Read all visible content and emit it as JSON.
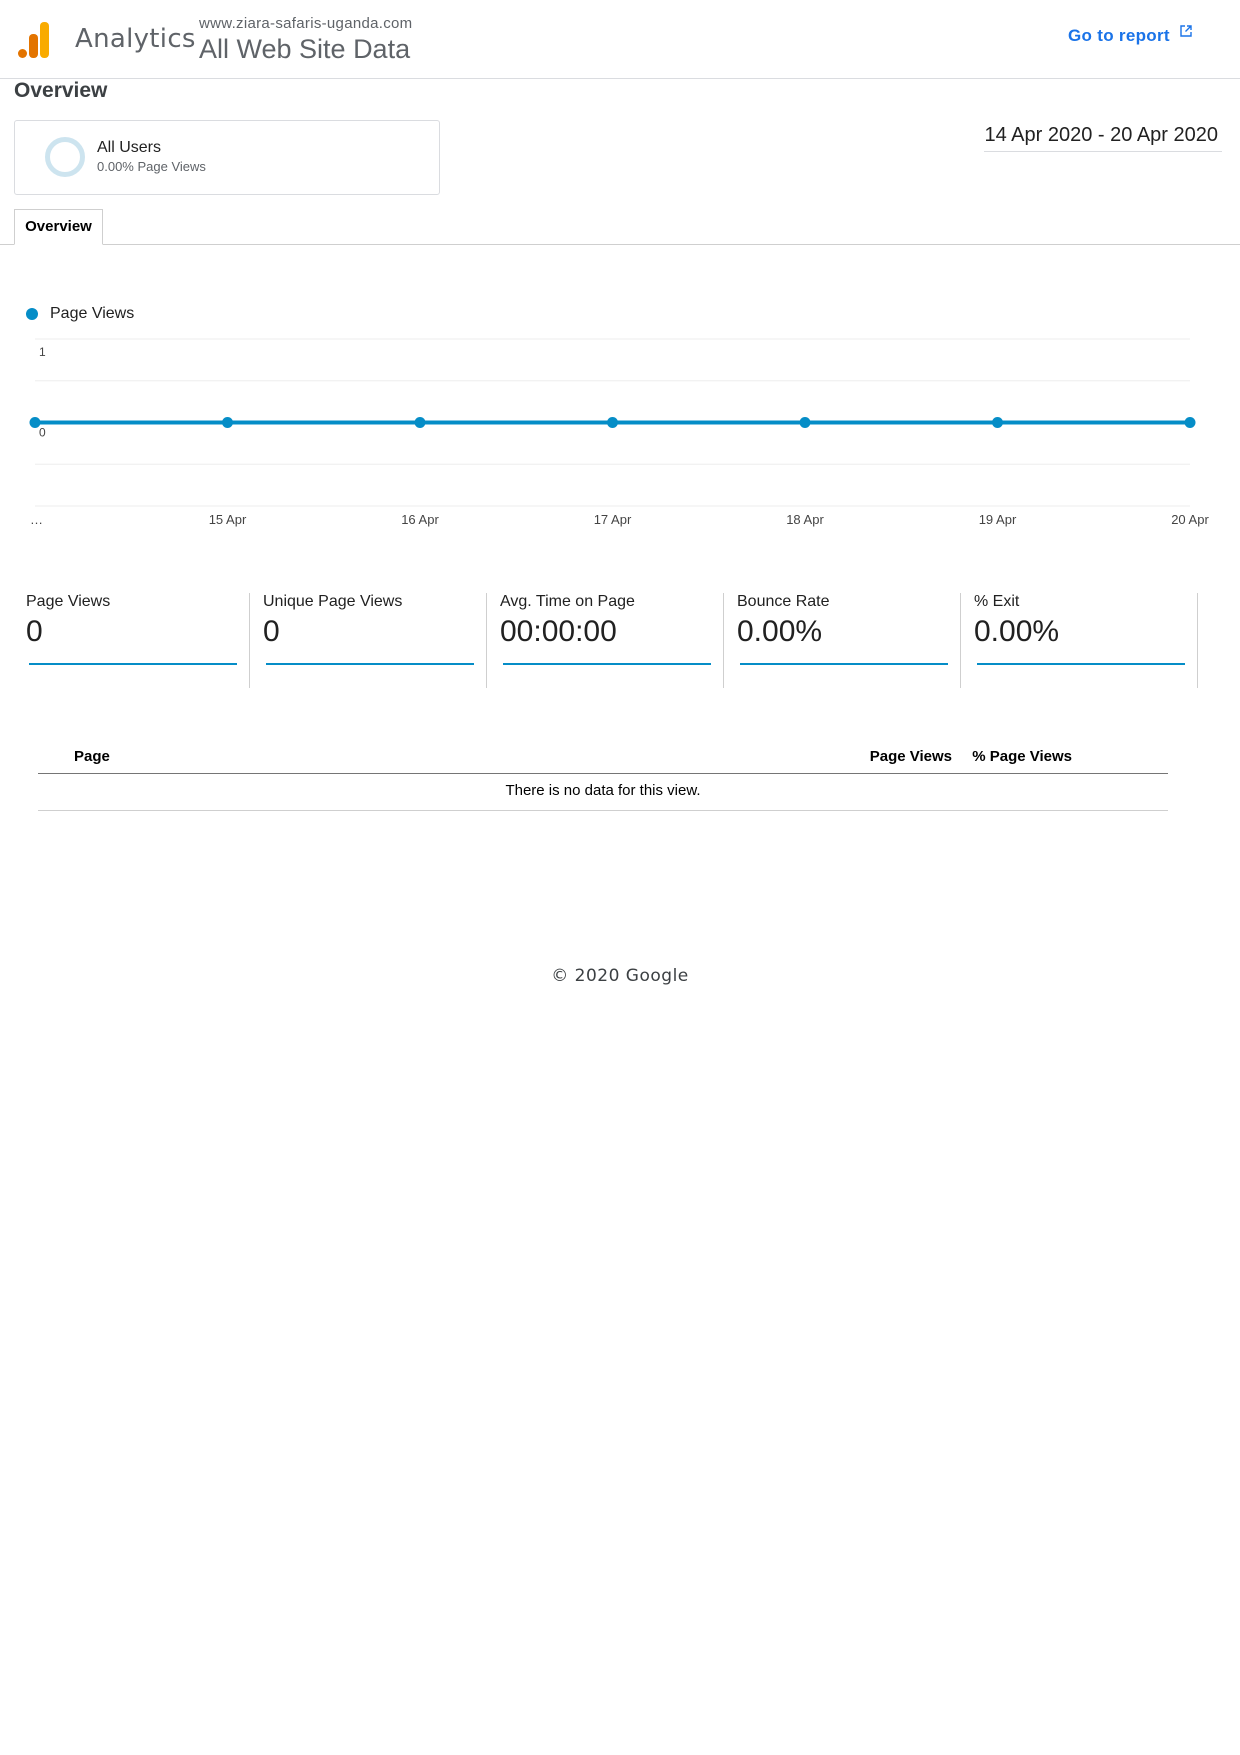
{
  "header": {
    "brand": "Analytics",
    "site_url": "www.ziara-safaris-uganda.com",
    "view_name": "All Web Site Data",
    "goto_label": "Go to report"
  },
  "overview_title": "Overview",
  "segment": {
    "name": "All Users",
    "subtitle": "0.00% Page Views"
  },
  "date_range": "14 Apr 2020 - 20 Apr 2020",
  "tabs": [
    {
      "label": "Overview"
    }
  ],
  "colors": {
    "accent": "#058dc7",
    "link": "#1a73e8",
    "logo_orange": "#f9ab00",
    "logo_dark_orange": "#e37400"
  },
  "chart_data": {
    "type": "line",
    "series": [
      {
        "name": "Page Views",
        "values": [
          0,
          0,
          0,
          0,
          0,
          0,
          0
        ]
      }
    ],
    "categories": [
      "…",
      "15 Apr",
      "16 Apr",
      "17 Apr",
      "18 Apr",
      "19 Apr",
      "20 Apr"
    ],
    "y_ticks": [
      "1",
      "0"
    ],
    "ylim": [
      -1,
      1
    ],
    "grid": true,
    "legend": "top-left"
  },
  "metrics": [
    {
      "label": "Page Views",
      "value": "0"
    },
    {
      "label": "Unique Page Views",
      "value": "0"
    },
    {
      "label": "Avg. Time on Page",
      "value": "00:00:00"
    },
    {
      "label": "Bounce Rate",
      "value": "0.00%"
    },
    {
      "label": "% Exit",
      "value": "0.00%"
    }
  ],
  "table": {
    "columns": [
      "Page",
      "Page Views",
      "% Page Views"
    ],
    "empty_message": "There is no data for this view."
  },
  "footer": "© 2020 Google"
}
